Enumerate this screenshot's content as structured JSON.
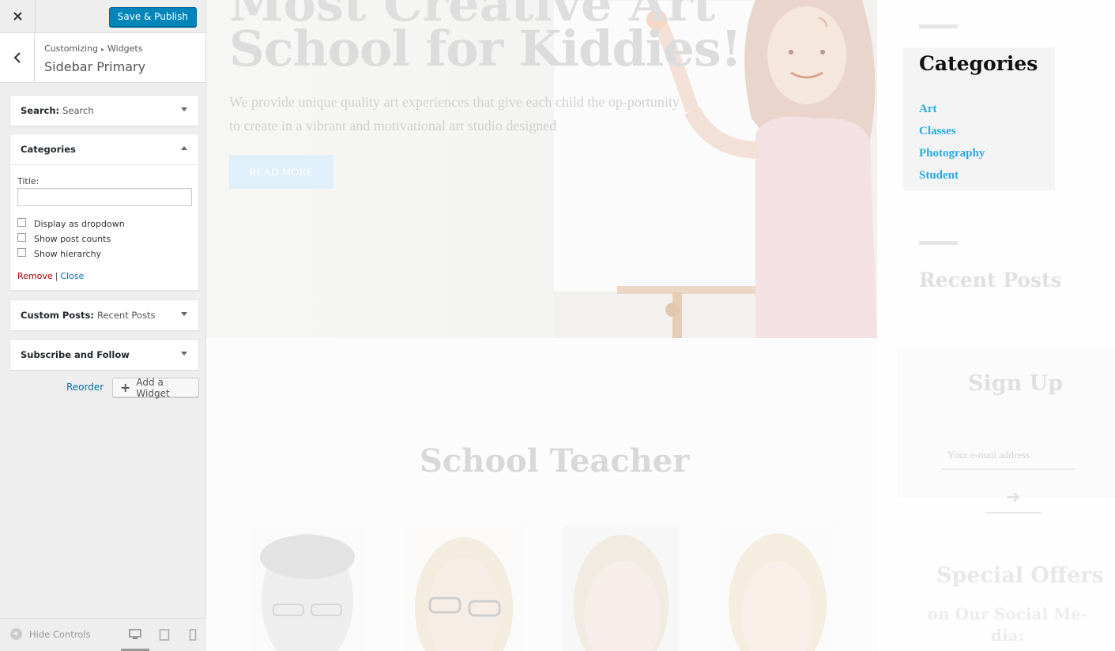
{
  "customizer": {
    "close_icon": "close-icon",
    "publish_label": "Save & Publish",
    "breadcrumb": {
      "root": "Customizing",
      "separator": "▸",
      "section": "Widgets"
    },
    "section_title": "Sidebar Primary",
    "widgets": [
      {
        "name": "Search:",
        "subtitle": "Search",
        "expanded": false
      },
      {
        "name": "Categories",
        "subtitle": "",
        "expanded": true,
        "title_label": "Title:",
        "title_value": "",
        "options": [
          {
            "label": "Display as dropdown",
            "checked": false
          },
          {
            "label": "Show post counts",
            "checked": false
          },
          {
            "label": "Show hierarchy",
            "checked": false
          }
        ],
        "remove_label": "Remove",
        "separator": "|",
        "close_label": "Close"
      },
      {
        "name": "Custom Posts:",
        "subtitle": "Recent Posts",
        "expanded": false
      },
      {
        "name": "Subscribe and Follow",
        "subtitle": "",
        "expanded": false
      }
    ],
    "reorder_label": "Reorder",
    "add_widget_label": "Add a Widget",
    "footer": {
      "hide_controls_label": "Hide Controls",
      "devices": [
        "desktop",
        "tablet",
        "mobile"
      ],
      "active_device": "desktop"
    },
    "accent_color": "#0085ba"
  },
  "preview": {
    "hero": {
      "title_line1": "Most Creative Art",
      "title_line2": "School for Kiddies!",
      "text": "We provide unique quality art experiences that give each child the op-portunity to create in a vibrant and motivational art studio designed",
      "button_label": "READ MORE"
    },
    "sidebar": {
      "categories_title": "Categories",
      "categories": [
        "Art",
        "Classes",
        "Photography",
        "Student"
      ],
      "recent_posts_title": "Recent Posts",
      "signup_title": "Sign Up",
      "signup_placeholder": "Your e-mail address",
      "signup_arrow": "➔",
      "offers_title": "Special Offers",
      "offers_subtitle": "on Our Social Me-dia:"
    },
    "teachers_title": "School Teacher",
    "link_color": "#29aae3"
  }
}
